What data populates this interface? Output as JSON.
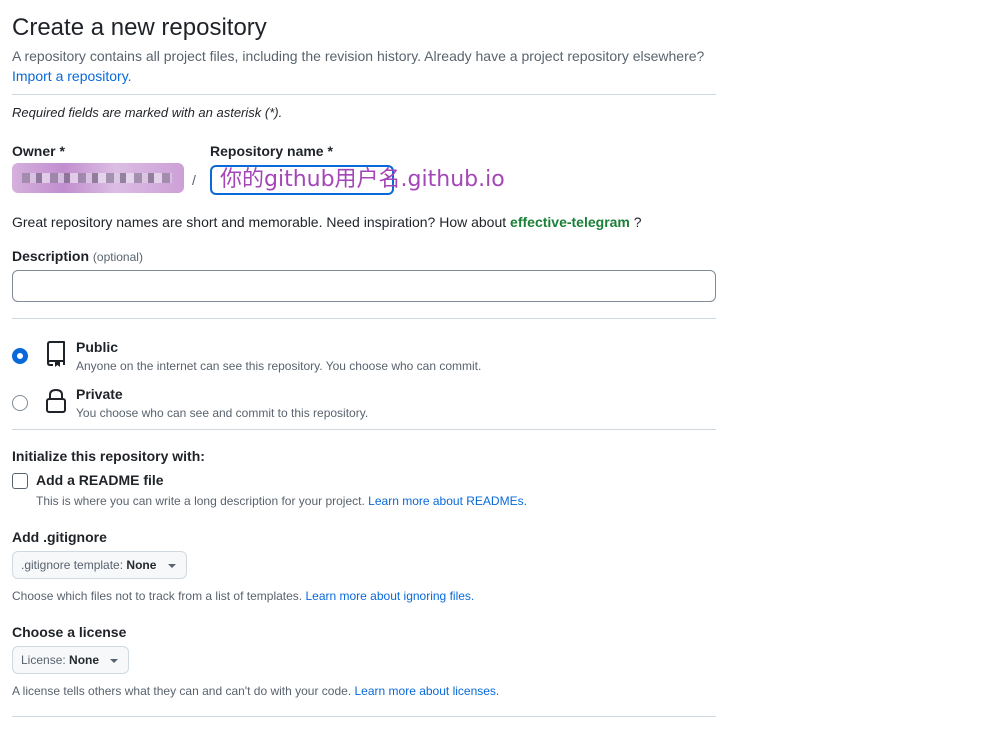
{
  "page": {
    "title": "Create a new repository",
    "intro": "A repository contains all project files, including the revision history. Already have a project repository elsewhere?",
    "import_link": "Import a repository.",
    "required_note": "Required fields are marked with an asterisk (*)."
  },
  "owner": {
    "label": "Owner *",
    "separator": "/"
  },
  "repo_name": {
    "label": "Repository name *",
    "value": "你的github用户名.github.io"
  },
  "hint": {
    "text": "Great repository names are short and memorable. Need inspiration? How about",
    "suggestion": "effective-telegram",
    "end": "?"
  },
  "description": {
    "label": "Description",
    "optional": "(optional)",
    "value": ""
  },
  "visibility": {
    "selected": "public",
    "options": [
      {
        "id": "public",
        "title": "Public",
        "subtitle": "Anyone on the internet can see this repository. You choose who can commit.",
        "icon": "repo-icon"
      },
      {
        "id": "private",
        "title": "Private",
        "subtitle": "You choose who can see and commit to this repository.",
        "icon": "lock-icon"
      }
    ]
  },
  "initialize": {
    "heading": "Initialize this repository with:",
    "readme": {
      "label": "Add a README file",
      "checked": false,
      "help": "This is where you can write a long description for your project.",
      "link": "Learn more about READMEs."
    }
  },
  "gitignore": {
    "label": "Add .gitignore",
    "dropdown_prefix": ".gitignore template:",
    "dropdown_value": "None",
    "help": "Choose which files not to track from a list of templates.",
    "link": "Learn more about ignoring files."
  },
  "license": {
    "label": "Choose a license",
    "dropdown_prefix": "License:",
    "dropdown_value": "None",
    "help": "A license tells others what they can and can't do with your code.",
    "link": "Learn more about licenses."
  },
  "colors": {
    "link": "#0969da",
    "suggestion": "#1a7f37",
    "repo_name_text": "#a546b8",
    "focus_border": "#0969da"
  }
}
